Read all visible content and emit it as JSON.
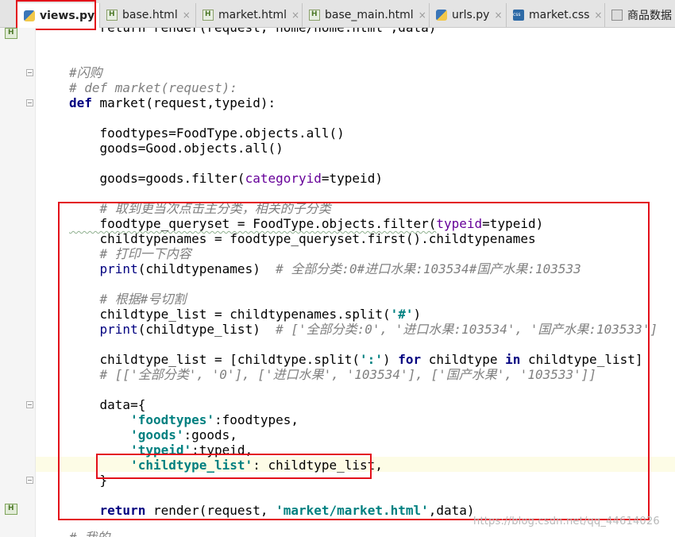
{
  "tabs": [
    {
      "label": "views.py",
      "icon": "python-file-icon",
      "active": true
    },
    {
      "label": "base.html",
      "icon": "html-file-icon",
      "active": false
    },
    {
      "label": "market.html",
      "icon": "html-file-icon",
      "active": false
    },
    {
      "label": "base_main.html",
      "icon": "html-file-icon",
      "active": false
    },
    {
      "label": "urls.py",
      "icon": "python-file-icon",
      "active": false
    },
    {
      "label": "market.css",
      "icon": "css-file-icon",
      "active": false
    },
    {
      "label": "商品数据",
      "icon": "data-file-icon",
      "active": false
    }
  ],
  "tab_close_glyph": "×",
  "code": {
    "l_top": "    return render(request,'home/home.html',data)",
    "l_c1": "#闪购",
    "l_c2": "# def market(request):",
    "l_def_kw": "def",
    "l_def_rest": " market(request,typeid):",
    "l_foodtypes": "    foodtypes=FoodType.objects.all()",
    "l_goods1": "    goods=Good.objects.all()",
    "l_goods2_a": "    goods=goods.filter(",
    "l_goods2_p": "categoryid",
    "l_goods2_b": "=typeid)",
    "l_c3": "    # 取到更当次点击主分类，相关的子分类",
    "l_fq_a": "    foodtype_queryset = FoodType.objects.filter(",
    "l_fq_p": "typeid",
    "l_fq_b": "=typeid)",
    "l_ctn": "    childtypenames = foodtype_queryset.first().childtypenames",
    "l_c4": "    # 打印一下内容",
    "l_pr1_kw": "print",
    "l_pr1_rest": "(childtypenames)  ",
    "l_pr1_cm": "# 全部分类:0#进口水果:103534#国产水果:103533",
    "l_c5": "    # 根据#号切割",
    "l_split_a": "    childtype_list = childtypenames.split(",
    "l_split_s": "'#'",
    "l_split_b": ")",
    "l_pr2_kw": "print",
    "l_pr2_rest": "(childtype_list)  ",
    "l_pr2_cm": "# ['全部分类:0', '进口水果:103534', '国产水果:103533']",
    "l_lc_a": "    childtype_list = [childtype.split(",
    "l_lc_s": "':'",
    "l_lc_b": ") ",
    "l_lc_for": "for",
    "l_lc_c": " childtype ",
    "l_lc_in": "in",
    "l_lc_d": " childtype_list]",
    "l_c6": "    # [['全部分类', '0'], ['进口水果', '103534'], ['国产水果', '103533']]",
    "l_data": "    data={",
    "l_d1_s": "'foodtypes'",
    "l_d1_r": ":foodtypes,",
    "l_d2_s": "'goods'",
    "l_d2_r": ":goods,",
    "l_d3_s": "'typeid'",
    "l_d3_r": ":typeid,",
    "l_d4_s": "'childtype_list'",
    "l_d4_r": ": childtype_list,",
    "l_close": "    }",
    "l_ret_kw": "return",
    "l_ret_a": " render(request, ",
    "l_ret_s": "'market/market.html'",
    "l_ret_b": ",data)",
    "l_bottom": "# 我的"
  },
  "watermark": "https://blog.csdn.net/qq_44614026",
  "colors": {
    "keyword": "#000080",
    "comment": "#808080",
    "string": "#008080",
    "param": "#660099",
    "highlight_box": "#e3101a",
    "current_line": "#fdfce6"
  }
}
